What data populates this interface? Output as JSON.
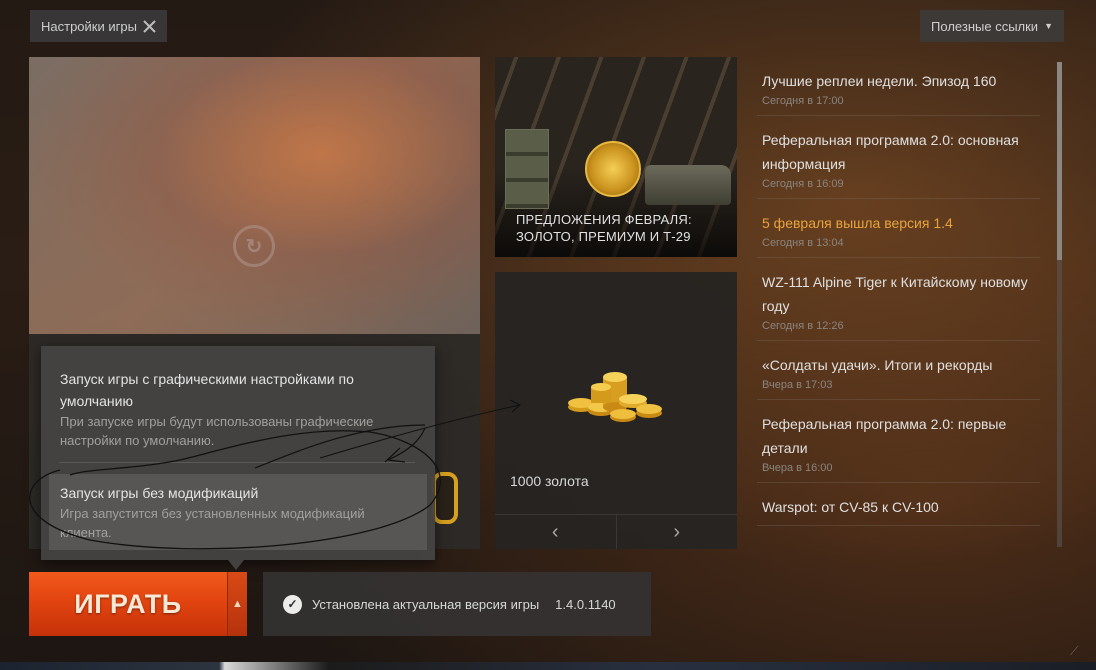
{
  "topbar": {
    "settings_label": "Настройки игры",
    "links_label": "Полезные ссылки"
  },
  "promo": {
    "title_line1": "ПРЕДЛОЖЕНИЯ ФЕВРАЛЯ:",
    "title_line2": "ЗОЛОТО, ПРЕМИУМ И Т-29"
  },
  "gold_offer": {
    "label": "1000 золота"
  },
  "news": [
    {
      "title": "Лучшие реплеи недели. Эпизод 160",
      "date": "Сегодня в 17:00",
      "highlight": false
    },
    {
      "title": "Реферальная программа 2.0: основная информация",
      "date": "Сегодня в 16:09",
      "highlight": false
    },
    {
      "title": "5 февраля вышла версия 1.4",
      "date": "Сегодня в 13:04",
      "highlight": true
    },
    {
      "title": "WZ-111 Alpine Tiger к Китайскому новому году",
      "date": "Сегодня в 12:26",
      "highlight": false
    },
    {
      "title": "«Солдаты удачи». Итоги и рекорды",
      "date": "Вчера в 17:03",
      "highlight": false
    },
    {
      "title": "Реферальная программа 2.0: первые детали",
      "date": "Вчера в 16:00",
      "highlight": false
    },
    {
      "title": "Warspot: от CV-85 к CV-100",
      "date": "",
      "highlight": false
    }
  ],
  "launch_menu": {
    "option1": {
      "title": "Запуск игры с графическими настройками по умолчанию",
      "desc": "При запуске игры будут использованы графические настройки по умолчанию."
    },
    "option2": {
      "title": "Запуск игры без модификаций",
      "desc": "Игра запустится без установленных модификаций клиента."
    }
  },
  "play": {
    "label": "ИГРАТЬ"
  },
  "status": {
    "text": "Установлена актуальная версия игры",
    "version": "1.4.0.1140"
  },
  "colors": {
    "accent_orange": "#e24410",
    "news_highlight": "#e8a33c"
  }
}
